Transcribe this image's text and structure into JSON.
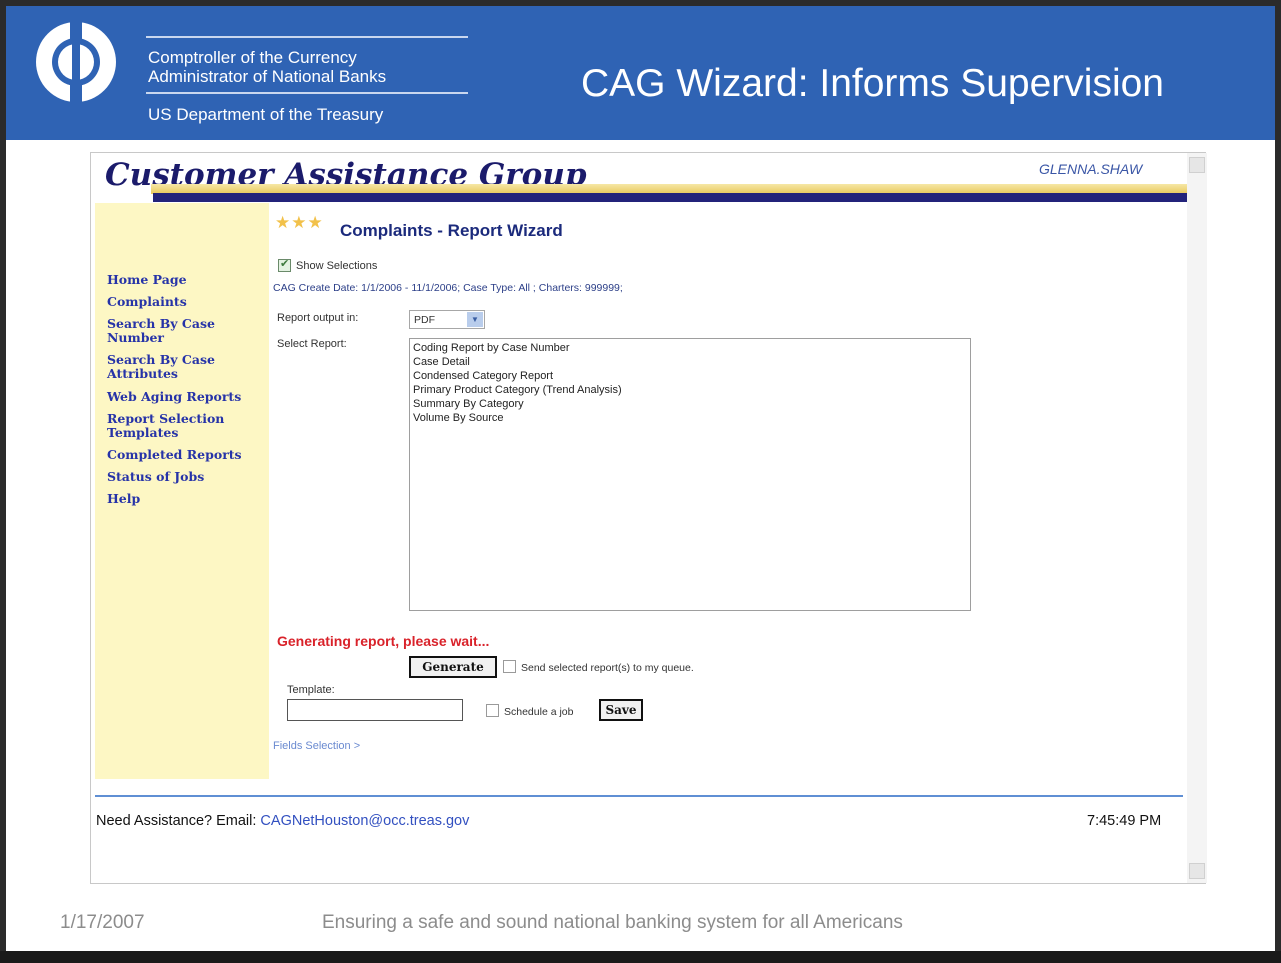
{
  "header": {
    "agency_line1": "Comptroller of the Currency",
    "agency_line2": "Administrator of National Banks",
    "agency_line3": "US Department of the Treasury",
    "slide_title": "CAG Wizard: Informs Supervision",
    "banner_color": "#2f63b4"
  },
  "app": {
    "title": "Customer Assistance Group",
    "user": "GLENNA.SHAW",
    "nav": [
      {
        "label": "Home Page"
      },
      {
        "label": "Complaints"
      },
      {
        "label": "Search By Case Number"
      },
      {
        "label": "Search By Case Attributes"
      },
      {
        "label": "Web Aging Reports"
      },
      {
        "label": "Report Selection Templates"
      },
      {
        "label": "Completed Reports"
      },
      {
        "label": "Status of Jobs"
      },
      {
        "label": "Help"
      }
    ],
    "wizard_title": "Complaints - Report Wizard",
    "show_selections_label": "Show Selections",
    "show_selections_checked": true,
    "criteria": "CAG Create Date: 1/1/2006 - 11/1/2006; Case Type: All ; Charters: 999999;",
    "output_label": "Report output in:",
    "output_value": "PDF",
    "select_report_label": "Select Report:",
    "reports": [
      "Coding Report by Case Number",
      "Case Detail",
      "Condensed Category Report",
      "Primary Product Category (Trend Analysis)",
      "Summary By Category",
      "Volume By Source"
    ],
    "generating_message": "Generating report, please wait...",
    "generate_button": "Generate",
    "queue_label": "Send selected report(s) to my queue.",
    "template_label": "Template:",
    "template_value": "",
    "schedule_label": "Schedule a job",
    "save_button": "Save",
    "fields_link": "Fields Selection  >",
    "assist_prefix": "Need Assistance? Email:",
    "assist_email": "CAGNetHouston@occ.treas.gov",
    "clock": "7:45:49 PM"
  },
  "footer": {
    "date": "1/17/2007",
    "tagline": "Ensuring a safe and sound national banking system for all Americans"
  }
}
